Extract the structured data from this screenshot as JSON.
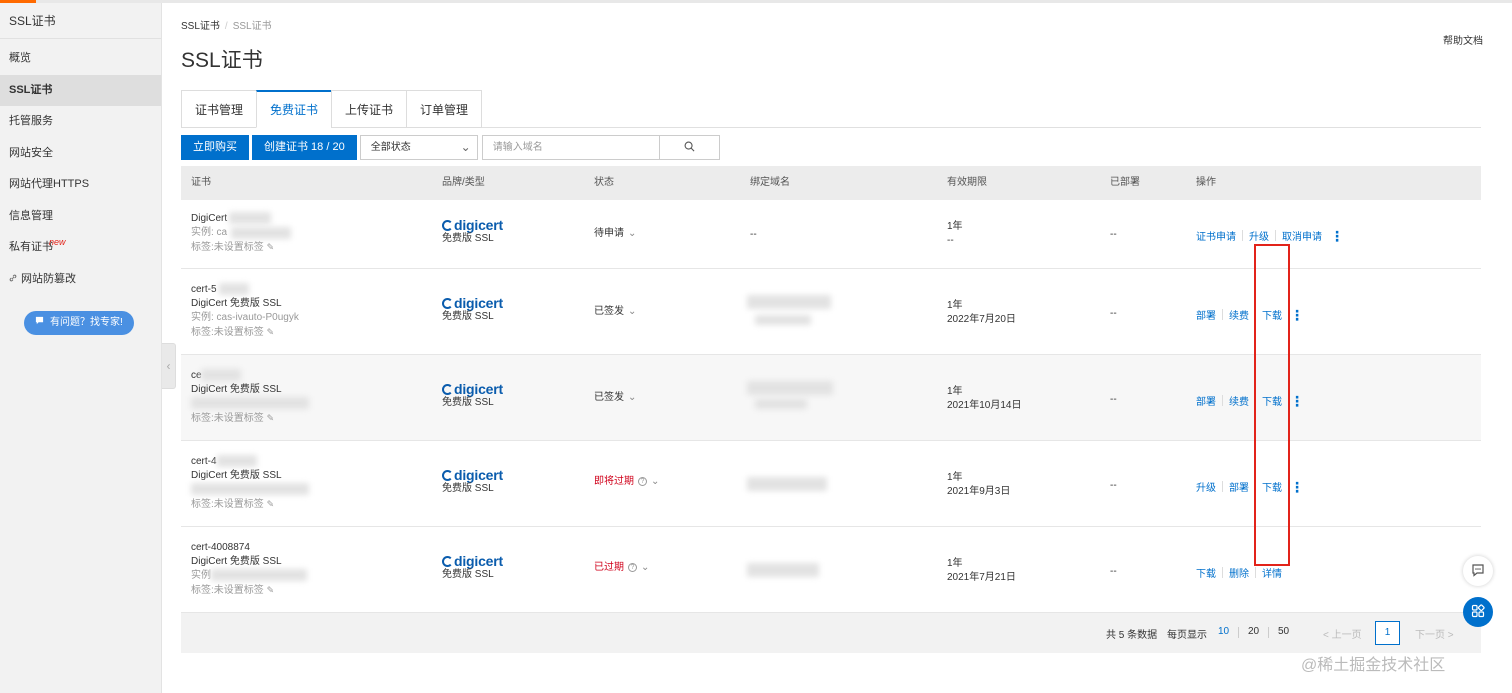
{
  "sidebar": {
    "title": "SSL证书",
    "items": [
      {
        "label": "概览",
        "active": false
      },
      {
        "label": "SSL证书",
        "active": true
      },
      {
        "label": "托管服务",
        "active": false
      },
      {
        "label": "网站安全",
        "active": false
      },
      {
        "label": "网站代理HTTPS",
        "active": false
      },
      {
        "label": "信息管理",
        "active": false
      },
      {
        "label": "私有证书",
        "active": false,
        "badge": "new"
      },
      {
        "label": "网站防篡改",
        "active": false,
        "icon": "link-icon"
      }
    ],
    "expert_button": "有问题？找专家!"
  },
  "breadcrumb": [
    "SSL证书",
    "SSL证书"
  ],
  "page_title": "SSL证书",
  "help_link": "帮助文档",
  "tabs": [
    {
      "label": "证书管理",
      "active": false
    },
    {
      "label": "免费证书",
      "active": true
    },
    {
      "label": "上传证书",
      "active": false
    },
    {
      "label": "订单管理",
      "active": false
    }
  ],
  "toolbar": {
    "buy_label": "立即购买",
    "create_label": "创建证书 18 / 20",
    "status_select": "全部状态",
    "search_placeholder": "请输入域名"
  },
  "table": {
    "headers": [
      "证书",
      "品牌/类型",
      "状态",
      "绑定域名",
      "有效期限",
      "已部署",
      "操作"
    ],
    "rows": [
      {
        "cert_lines": [
          "DigiCert",
          "实例: ca",
          "标签:未设置标签"
        ],
        "brand": "digicert",
        "brand_type": "免费版 SSL",
        "status": "待申请",
        "status_red": false,
        "status_help": false,
        "domain": "--",
        "validity": "1年",
        "expire": "--",
        "deployed": "--",
        "ops": [
          "证书申请",
          "升级",
          "取消申请"
        ]
      },
      {
        "cert_lines": [
          "cert-5",
          "DigiCert 免费版 SSL",
          "实例: cas-ivauto-P0ugyk",
          "标签:未设置标签"
        ],
        "brand": "digicert",
        "brand_type": "免费版 SSL",
        "status": "已签发",
        "status_red": false,
        "status_help": false,
        "domain": "",
        "validity": "1年",
        "expire": "2022年7月20日",
        "deployed": "--",
        "ops": [
          "部署",
          "续费",
          "下载"
        ]
      },
      {
        "cert_lines": [
          "ce",
          "DigiCert 免费版 SSL",
          "",
          "标签:未设置标签"
        ],
        "brand": "digicert",
        "brand_type": "免费版 SSL",
        "status": "已签发",
        "status_red": false,
        "status_help": false,
        "domain": "",
        "validity": "1年",
        "expire": "2021年10月14日",
        "deployed": "--",
        "ops": [
          "部署",
          "续费",
          "下载"
        ]
      },
      {
        "cert_lines": [
          "cert-4",
          "DigiCert 免费版 SSL",
          "",
          "标签:未设置标签"
        ],
        "brand": "digicert",
        "brand_type": "免费版 SSL",
        "status": "即将过期",
        "status_red": true,
        "status_help": true,
        "domain": "",
        "validity": "1年",
        "expire": "2021年9月3日",
        "deployed": "--",
        "ops": [
          "升级",
          "部署",
          "下载"
        ]
      },
      {
        "cert_lines": [
          "cert-4008874",
          "DigiCert 免费版 SSL",
          "实例",
          "标签:未设置标签"
        ],
        "brand": "digicert",
        "brand_type": "免费版 SSL",
        "status": "已过期",
        "status_red": true,
        "status_help": true,
        "domain": "",
        "validity": "1年",
        "expire": "2021年7月21日",
        "deployed": "--",
        "ops": [
          "下载",
          "删除",
          "详情"
        ]
      }
    ]
  },
  "pagination": {
    "total": "共 5 条数据",
    "per_page_label": "每页显示",
    "sizes": [
      "10",
      "20",
      "50"
    ],
    "active_size": "10",
    "prev": "< 上一页",
    "page": "1",
    "next": "下一页 >"
  },
  "watermark": "@稀土掘金技术社区",
  "colors": {
    "primary": "#0070cc",
    "accent": "#ff6a00",
    "danger": "#d0021b",
    "highlight": "#e2231a"
  }
}
